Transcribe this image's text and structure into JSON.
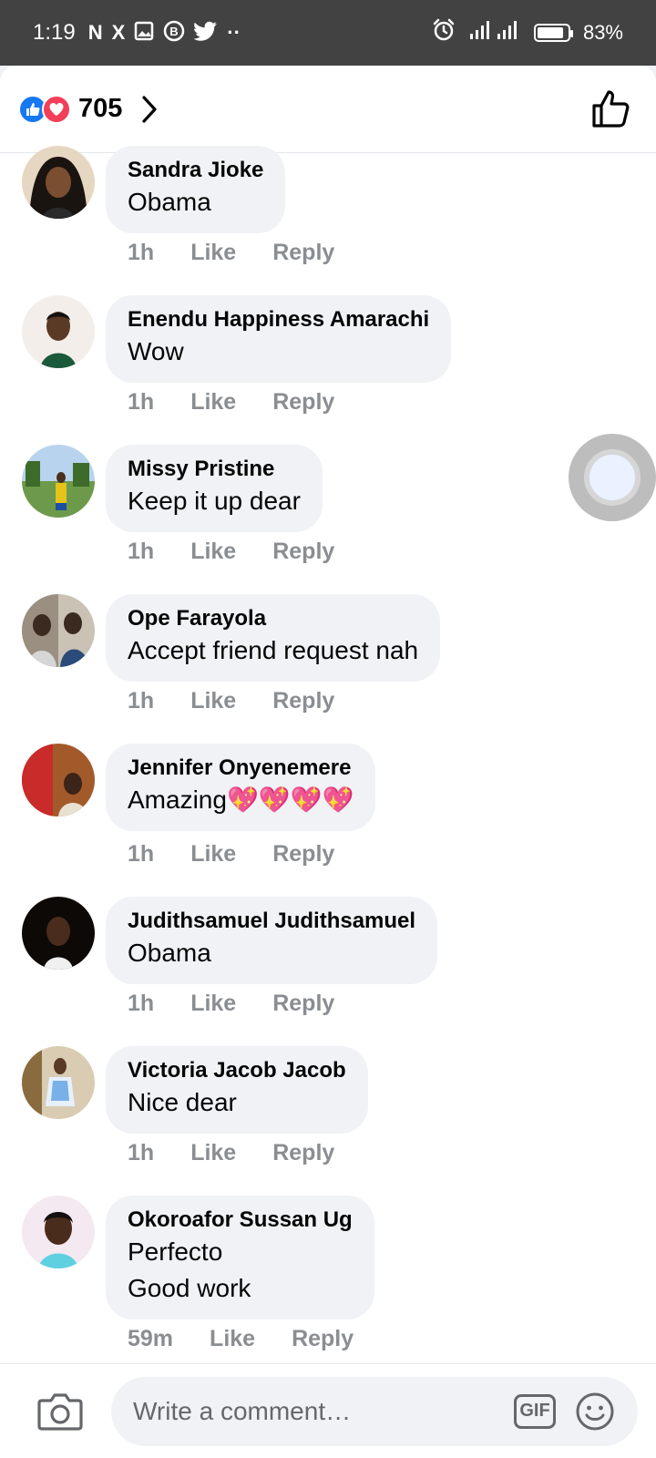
{
  "status_bar": {
    "time": "1:19",
    "left_icons": [
      "N",
      "X",
      "▣",
      "B",
      "twitter",
      "··"
    ],
    "battery": "83%"
  },
  "header": {
    "reaction_count": "705",
    "reaction_icons": [
      "like-icon",
      "love-icon"
    ]
  },
  "comments": [
    {
      "name": "Sandra Jioke",
      "lines": [
        "Obama"
      ],
      "time": "1h",
      "like": "Like",
      "reply": "Reply"
    },
    {
      "name": "Enendu Happiness Amarachi",
      "lines": [
        "Wow"
      ],
      "time": "1h",
      "like": "Like",
      "reply": "Reply"
    },
    {
      "name": "Missy Pristine",
      "lines": [
        "Keep it up dear"
      ],
      "time": "1h",
      "like": "Like",
      "reply": "Reply"
    },
    {
      "name": "Ope Farayola",
      "lines": [
        "Accept friend request nah"
      ],
      "time": "1h",
      "like": "Like",
      "reply": "Reply"
    },
    {
      "name": "Jennifer Onyenemere",
      "lines": [
        "Amazing💖💖💖💖"
      ],
      "time": "1h",
      "like": "Like",
      "reply": "Reply"
    },
    {
      "name": "Judithsamuel Judithsamuel",
      "lines": [
        "Obama"
      ],
      "time": "1h",
      "like": "Like",
      "reply": "Reply"
    },
    {
      "name": "Victoria Jacob Jacob",
      "lines": [
        "Nice dear"
      ],
      "time": "1h",
      "like": "Like",
      "reply": "Reply"
    },
    {
      "name": "Okoroafor Sussan Ug",
      "lines": [
        "Perfecto",
        "Good work"
      ],
      "time": "59m",
      "like": "Like",
      "reply": "Reply"
    }
  ],
  "composer": {
    "placeholder": "Write a comment…",
    "gif_label": "GIF"
  },
  "colors": {
    "brand_blue": "#1877f2",
    "love_red": "#f33e58",
    "bubble_bg": "#f0f2f5",
    "meta_gray": "#8a8d91"
  }
}
